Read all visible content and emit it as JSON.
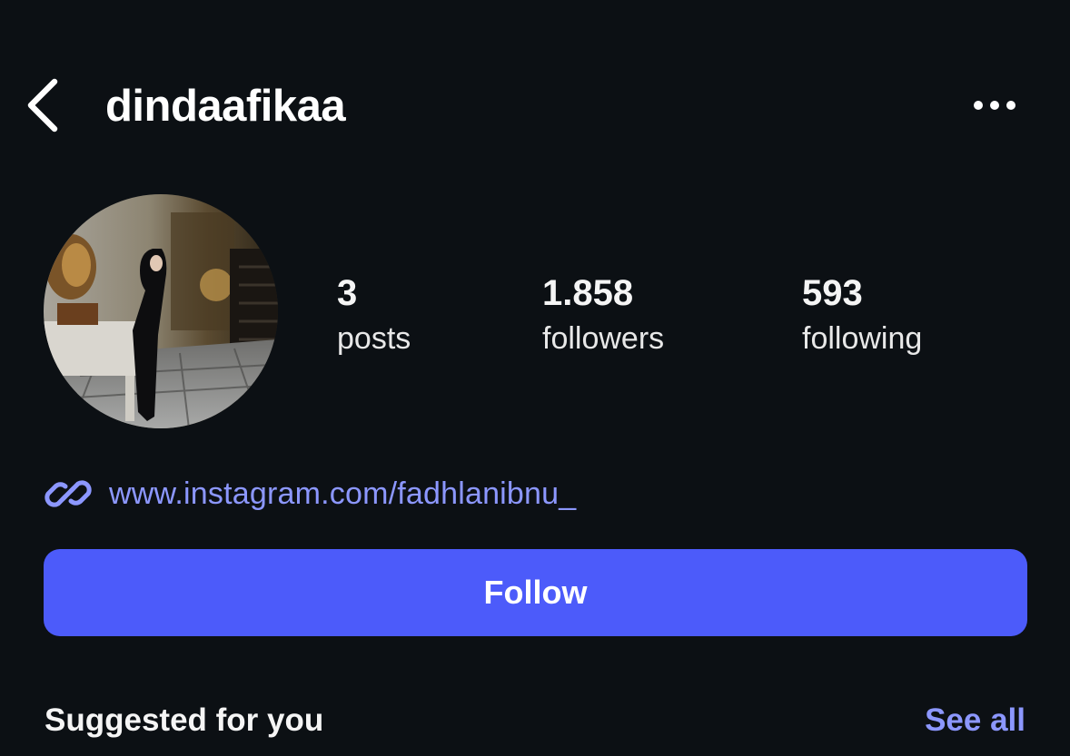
{
  "header": {
    "back_icon": "chevron-left-icon",
    "username": "dindaafikaa",
    "more_icon": "ellipsis-horizontal-icon"
  },
  "profile": {
    "avatar_icon": "profile-photo",
    "stats": {
      "posts": {
        "count": "3",
        "label": "posts"
      },
      "followers": {
        "count": "1.858",
        "label": "followers"
      },
      "following": {
        "count": "593",
        "label": "following"
      }
    },
    "link": {
      "icon": "link-icon",
      "text": "www.instagram.com/fadhlanibnu_"
    }
  },
  "actions": {
    "follow_label": "Follow"
  },
  "suggested": {
    "title": "Suggested for you",
    "see_all_label": "See all"
  },
  "colors": {
    "background": "#0c1014",
    "accent": "#4c5bfa",
    "link": "#8c97ff",
    "text": "#f5f5f5"
  }
}
